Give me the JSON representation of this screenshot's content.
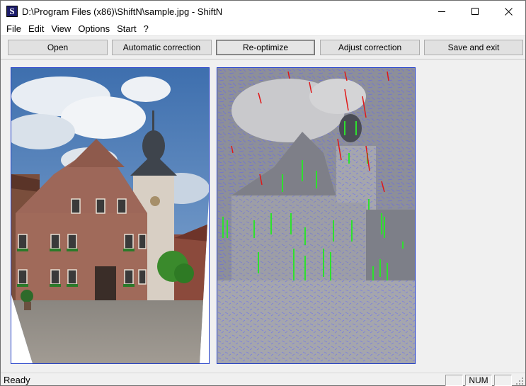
{
  "window": {
    "title": "D:\\Program Files (x86)\\ShiftN\\sample.jpg - ShiftN",
    "app_icon_letter": "S"
  },
  "menu": [
    "File",
    "Edit",
    "View",
    "Options",
    "Start",
    "?"
  ],
  "toolbar": {
    "open": "Open",
    "automatic_correction": "Automatic correction",
    "reoptimize": "Re-optimize",
    "adjust_correction": "Adjust correction",
    "save_and_exit": "Save and exit"
  },
  "status": {
    "text": "Ready",
    "indicator_1": "",
    "num": "NUM",
    "indicator_3": ""
  }
}
